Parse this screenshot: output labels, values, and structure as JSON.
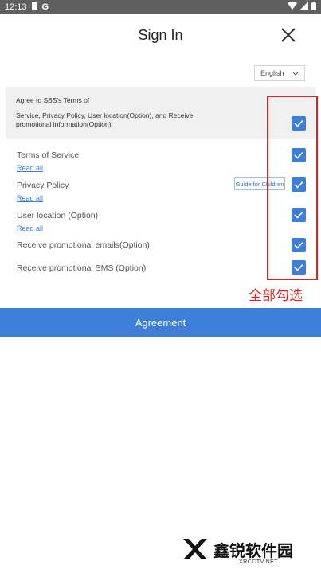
{
  "status_bar": {
    "time": "12:13",
    "app_letter": "G"
  },
  "header": {
    "title": "Sign In"
  },
  "language": {
    "selected": "English"
  },
  "agree_all": {
    "line1": "Agree to SBS's Terms of",
    "line2": "Service, Privacy Policy, User location(Option), and Receive promotional information(Option).",
    "checked": true
  },
  "terms": [
    {
      "label": "Terms of Service",
      "link": "Read all",
      "checked": true
    },
    {
      "label": "Privacy Policy",
      "link": "Read all",
      "extra_button": "Guide for Children",
      "checked": true
    },
    {
      "label": "User location (Option)",
      "link": "Read all",
      "checked": true
    },
    {
      "label": "Receive promotional emails(Option)",
      "checked": true
    },
    {
      "label": "Receive promotional SMS (Option)",
      "checked": true
    }
  ],
  "annotation": {
    "text": "全部勾选",
    "color": "#e02020"
  },
  "agreement_button": {
    "label": "Agreement"
  },
  "watermark": {
    "brand": "鑫锐软件园",
    "domain": "XRCCTV.NET"
  },
  "colors": {
    "accent": "#3d7fd6",
    "status_bar": "#5f5f5f",
    "panel": "#f0f0f0"
  }
}
